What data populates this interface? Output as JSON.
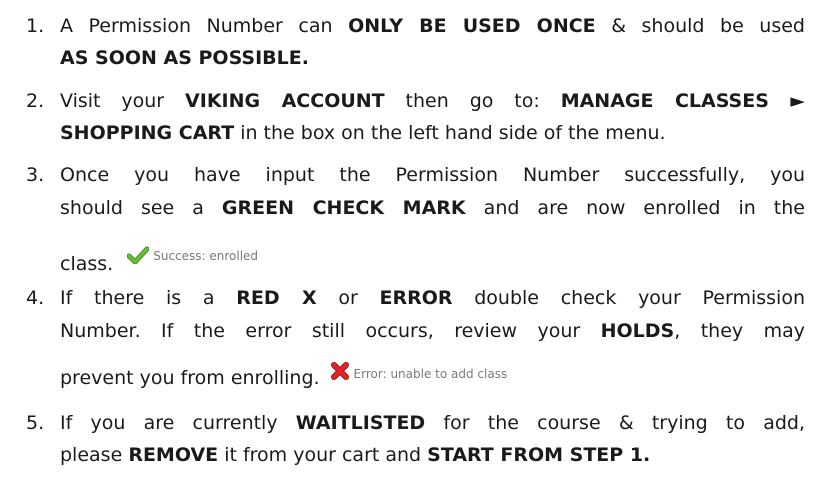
{
  "items": [
    {
      "number": "1.",
      "lines": [
        {
          "parts": [
            "A Permission Number can ",
            "ONLY BE USED ONCE",
            " & should be used"
          ]
        },
        {
          "parts": [
            "AS SOON AS POSSIBLE."
          ]
        }
      ]
    },
    {
      "number": "2.",
      "lines": [
        {
          "parts": [
            "Visit your ",
            "VIKING ACCOUNT",
            " then go to: ",
            "MANAGE CLASSES ►"
          ]
        },
        {
          "parts": [
            "SHOPPING CART",
            " in the box on the left hand side of the menu."
          ]
        }
      ]
    },
    {
      "number": "3.",
      "lines": [
        {
          "parts": [
            "Once you have input the Permission Number successfully, you"
          ]
        },
        {
          "parts": [
            "should see a ",
            "GREEN CHECK MARK",
            " and are now enrolled in the"
          ]
        },
        {
          "parts": [
            "class."
          ],
          "status_text": "Success: enrolled",
          "icon": "green-check-icon"
        }
      ]
    },
    {
      "number": "4.",
      "lines": [
        {
          "parts": [
            "If there is a ",
            "RED X",
            " or ",
            "ERROR",
            " double check your Permission"
          ]
        },
        {
          "parts": [
            "Number. If the error still occurs, review your ",
            "HOLDS",
            ", they may"
          ]
        },
        {
          "parts": [
            "prevent you from enrolling."
          ],
          "status_text": "Error: unable to add class",
          "icon": "red-x-icon"
        }
      ]
    },
    {
      "number": "5.",
      "lines": [
        {
          "parts": [
            "If you are currently ",
            "WAITLISTED",
            " for the course & trying to add,"
          ]
        },
        {
          "parts": [
            "please ",
            "REMOVE",
            " it from your cart and ",
            "START FROM STEP 1."
          ]
        }
      ]
    }
  ],
  "colors": {
    "text": "#1a1a1a",
    "status_text": "#7a7a7a",
    "check": "#5aa02c",
    "x": "#d0141a"
  }
}
